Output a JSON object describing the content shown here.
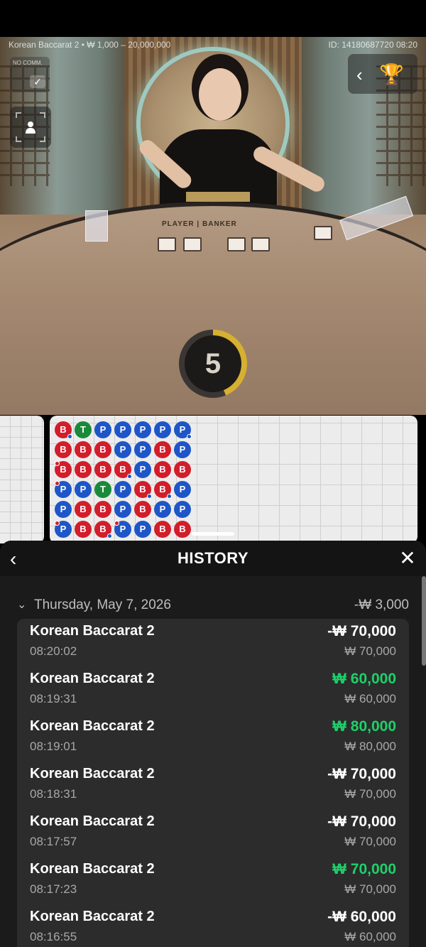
{
  "stream": {
    "table_info": "Korean Baccarat 2 • ₩ 1,000 – 20,000,000",
    "round_id": "ID: 14180687720 08:20",
    "no_comm_label": "NO COMM.",
    "table_text": "PLAYER | BANKER",
    "countdown": "5",
    "countdown_fraction": 0.44,
    "checkmark": "✓",
    "back_chevron": "‹",
    "trophy_glyph": "🏆"
  },
  "roadmap": {
    "columns": [
      [
        {
          "r": "B",
          "dot": "blue"
        },
        {
          "r": "B"
        },
        {
          "r": "B",
          "dot": "red"
        },
        {
          "r": "P",
          "dot": "red"
        },
        {
          "r": "P"
        },
        {
          "r": "P",
          "dot": "red"
        }
      ],
      [
        {
          "r": "T"
        },
        {
          "r": "B"
        },
        {
          "r": "B"
        },
        {
          "r": "P"
        },
        {
          "r": "B"
        },
        {
          "r": "B"
        }
      ],
      [
        {
          "r": "P"
        },
        {
          "r": "B"
        },
        {
          "r": "B"
        },
        {
          "r": "T"
        },
        {
          "r": "B"
        },
        {
          "r": "B",
          "dot": "blue"
        }
      ],
      [
        {
          "r": "P"
        },
        {
          "r": "P"
        },
        {
          "r": "B",
          "dot": "blue"
        },
        {
          "r": "P"
        },
        {
          "r": "P"
        },
        {
          "r": "P",
          "dot": "red"
        }
      ],
      [
        {
          "r": "P"
        },
        {
          "r": "P"
        },
        {
          "r": "P"
        },
        {
          "r": "B",
          "dot": "blue"
        },
        {
          "r": "B"
        },
        {
          "r": "P"
        }
      ],
      [
        {
          "r": "P"
        },
        {
          "r": "B"
        },
        {
          "r": "B"
        },
        {
          "r": "B",
          "dot": "blue"
        },
        {
          "r": "P"
        },
        {
          "r": "B"
        }
      ],
      [
        {
          "r": "P",
          "dot": "blue"
        },
        {
          "r": "P"
        },
        {
          "r": "B"
        },
        {
          "r": "P"
        },
        {
          "r": "P"
        },
        {
          "r": "B"
        }
      ]
    ]
  },
  "history": {
    "back_icon": "‹",
    "title": "HISTORY",
    "close_icon": "✕",
    "date_chevron": "⌄",
    "date": "Thursday, May 7, 2026",
    "date_total": "-₩ 3,000",
    "rows": [
      {
        "game": "Korean Baccarat 2",
        "time": "08:20:02",
        "amount": "-₩ 70,000",
        "stake": "₩ 70,000",
        "win": false
      },
      {
        "game": "Korean Baccarat 2",
        "time": "08:19:31",
        "amount": "₩ 60,000",
        "stake": "₩ 60,000",
        "win": true
      },
      {
        "game": "Korean Baccarat 2",
        "time": "08:19:01",
        "amount": "₩ 80,000",
        "stake": "₩ 80,000",
        "win": true
      },
      {
        "game": "Korean Baccarat 2",
        "time": "08:18:31",
        "amount": "-₩ 70,000",
        "stake": "₩ 70,000",
        "win": false
      },
      {
        "game": "Korean Baccarat 2",
        "time": "08:17:57",
        "amount": "-₩ 70,000",
        "stake": "₩ 70,000",
        "win": false
      },
      {
        "game": "Korean Baccarat 2",
        "time": "08:17:23",
        "amount": "₩ 70,000",
        "stake": "₩ 70,000",
        "win": true
      },
      {
        "game": "Korean Baccarat 2",
        "time": "08:16:55",
        "amount": "-₩ 60,000",
        "stake": "₩ 60,000",
        "win": false
      }
    ]
  },
  "colors": {
    "win": "#1dd16a",
    "banker": "#d21d2a",
    "player": "#1e56c8",
    "tie": "#1a8a3a",
    "timer": "#d6b030"
  }
}
